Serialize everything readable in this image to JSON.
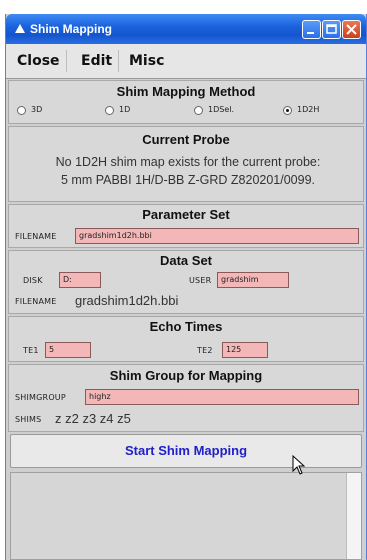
{
  "window": {
    "title": "Shim Mapping"
  },
  "menu": {
    "close": "Close",
    "edit": "Edit",
    "misc": "Misc"
  },
  "method": {
    "title": "Shim Mapping Method",
    "options": [
      "3D",
      "1D",
      "1DSel.",
      "1D2H"
    ],
    "selected": "1D2H"
  },
  "probe": {
    "title": "Current Probe",
    "line1": "No 1D2H shim map exists for the current probe:",
    "line2": "5 mm PABBI 1H/D-BB Z-GRD Z820201/0099."
  },
  "parameter_set": {
    "title": "Parameter Set",
    "filename_label": "FILENAME",
    "filename_value": "gradshim1d2h.bbi"
  },
  "data_set": {
    "title": "Data Set",
    "disk_label": "DISK",
    "disk_value": "D:",
    "user_label": "USER",
    "user_value": "gradshim",
    "filename_label": "FILENAME",
    "filename_value": "gradshim1d2h.bbi"
  },
  "echo_times": {
    "title": "Echo Times",
    "te1_label": "TE1",
    "te1_value": "5",
    "te2_label": "TE2",
    "te2_value": "125"
  },
  "shim_group": {
    "title": "Shim Group for Mapping",
    "group_label": "SHIMGROUP",
    "group_value": "highz",
    "shims_label": "SHIMS",
    "shims_value": "z z2 z3 z4 z5"
  },
  "start_button": "Start Shim Mapping"
}
